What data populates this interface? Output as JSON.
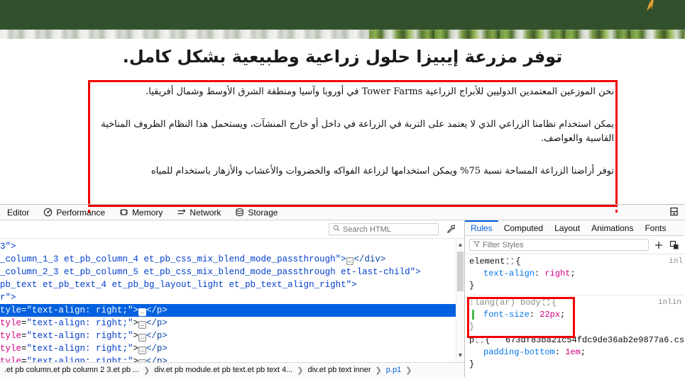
{
  "page": {
    "heading": "توفر مزرعة إيبيزا حلول زراعية وطبيعية بشكل كامل.",
    "paragraphs": [
      "نحن الموزعين المعتمدين الدوليين للأبراج الزراعية Tower Farms في أوروبا وآسيا ومنطقة الشرق الأوسط وشمال أفريقيا.",
      "يمكن استخدام نظامنا الزراعي الذي لا يعتمد على التربة في الزراعة في داخل أو خارج المنشآت، ويستحمل هذا النظام الظروف المناخية القاسية والعواصف.",
      "توفر أراضنا الزراعة المساحة نسبة 75% ويمكن استخدامها لزراعة الفواكه والخضروات والأعشاب والأزهار باستخدام للمياه"
    ]
  },
  "annotation": {
    "color": "#f10000"
  },
  "devtools": {
    "tabs": [
      {
        "label": "Editor",
        "icon": "editor-icon"
      },
      {
        "label": "Performance",
        "icon": "performance-icon"
      },
      {
        "label": "Memory",
        "icon": "memory-icon"
      },
      {
        "label": "Network",
        "icon": "network-icon"
      },
      {
        "label": "Storage",
        "icon": "storage-icon"
      }
    ],
    "dock_icon": "dock-split-icon",
    "inspector": {
      "search_placeholder": "Search HTML",
      "search_icon": "search-icon",
      "picker_icon": "eyedropper-icon",
      "markup_lines": [
        {
          "type": "plain",
          "text": "3\">"
        },
        {
          "type": "attrtail",
          "text": "_column_1_3 et_pb_column_4 et_pb_css_mix_blend_mode_passthrough\">",
          "closing": "</div>",
          "ellipsis": true
        },
        {
          "type": "attrtail",
          "text": "_column_2_3 et_pb_column_5 et_pb_css_mix_blend_mode_passthrough et-last-child\">",
          "closing": "",
          "ellipsis": false
        },
        {
          "type": "attrtail",
          "text": "pb_text et_pb_text_4 et_pb_bg_layout_light et_pb_text_align_right\">",
          "closing": "",
          "ellipsis": false
        },
        {
          "type": "plain",
          "text": "r\">"
        },
        {
          "type": "style",
          "attr": "tyle",
          "value": "\"text-align: right;\"",
          "closing": "</p>",
          "selected": true
        },
        {
          "type": "style",
          "attr": "tyle",
          "value": "\"text-align: right;\"",
          "closing": "</p>",
          "selected": false
        },
        {
          "type": "style",
          "attr": "tyle",
          "value": "\"text-align: right;\"",
          "closing": "</p>",
          "selected": false
        },
        {
          "type": "style",
          "attr": "tyle",
          "value": "\"text-align: right;\"",
          "closing": "</p>",
          "selected": false
        },
        {
          "type": "style",
          "attr": "tyle",
          "value": "\"text-align: right;\"",
          "closing": "</p>",
          "selected": false
        }
      ],
      "breadcrumb": [
        ".et pb column.et pb column 2 3.et pb ...",
        "div.et pb module.et pb text.et pb text 4...",
        "div.et pb text inner",
        "p.p1"
      ]
    },
    "rules": {
      "tabs": [
        "Rules",
        "Computed",
        "Layout",
        "Animations",
        "Fonts"
      ],
      "active_tab": "Rules",
      "filter_placeholder": "Filter Styles",
      "filter_icon": "funnel-icon",
      "add_rule_icon": "plus-icon",
      "pseudo_class_icon": "pseudo-class-icon",
      "entries": [
        {
          "selector": "element",
          "source": "inl",
          "declarations": [
            {
              "name": "text-align",
              "value": "right",
              "highlight": false
            }
          ],
          "highlighted": false
        },
        {
          "selector": ":lang(ar) body",
          "source": "inlin",
          "declarations": [
            {
              "name": "font-size",
              "value": "22px",
              "highlight": true
            }
          ],
          "highlighted": true
        },
        {
          "selector": "p",
          "source": "673df83ba21c54fdc9de36ab2e9877a6.cs",
          "declarations": [
            {
              "name": "padding-bottom",
              "value": "1em",
              "highlight": false
            }
          ],
          "highlighted": false
        }
      ]
    }
  }
}
